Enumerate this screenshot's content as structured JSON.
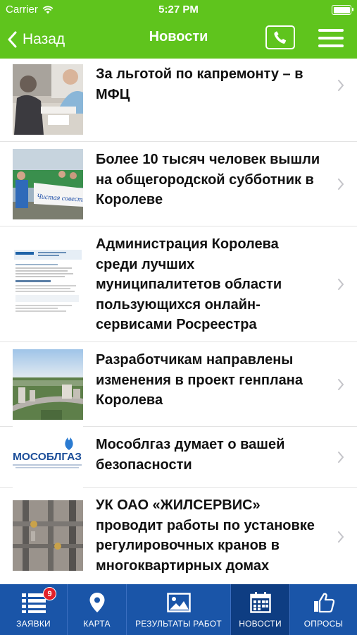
{
  "status_bar": {
    "carrier": "Carrier",
    "time": "5:27 PM"
  },
  "nav": {
    "back_label": "Назад",
    "title": "Новости"
  },
  "news": [
    {
      "title": "За льготой по капремонту – в МФЦ"
    },
    {
      "title": "Более 10 тысяч человек вышли на общегородской субботник в Королеве",
      "image_text": "Чистая совесть"
    },
    {
      "title": "Администрация Королева среди лучших муниципалитетов области пользующихся онлайн-сервисами Росреестра"
    },
    {
      "title": "Разработчикам направлены изменения в проект генплана Королева"
    },
    {
      "title": "Мособлгаз думает о вашей безопасности",
      "image_text": "МОСОБЛГАЗ"
    },
    {
      "title": "УК ОАО «ЖИЛСЕРВИС» проводит работы по установке регулировочных кранов в многоквартирных домах"
    }
  ],
  "tabs": [
    {
      "label": "ЗАЯВКИ",
      "badge": "9",
      "icon": "list-icon"
    },
    {
      "label": "КАРТА",
      "icon": "map-pin-icon"
    },
    {
      "label": "РЕЗУЛЬТАТЫ РАБОТ",
      "icon": "image-icon"
    },
    {
      "label": "НОВОСТИ",
      "icon": "calendar-icon",
      "active": true
    },
    {
      "label": "ОПРОСЫ",
      "icon": "thumbs-up-icon"
    }
  ],
  "colors": {
    "header": "#5fc41d",
    "tabbar": "#1a55a8",
    "tab_active": "#0e3d82",
    "badge": "#e2202a"
  }
}
